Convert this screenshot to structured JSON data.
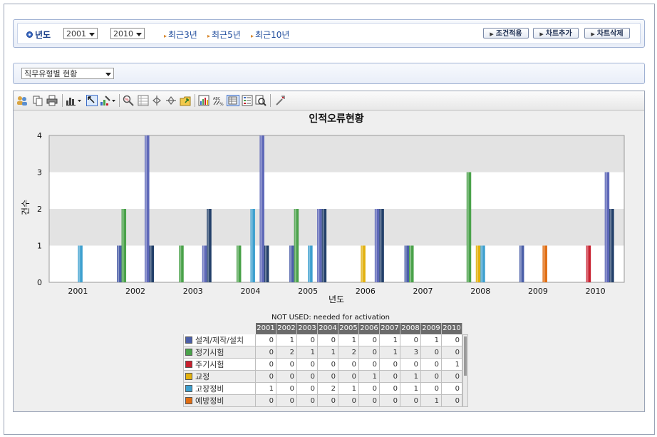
{
  "filter": {
    "year_label": "년도",
    "from_year": "2001",
    "to_year": "2010",
    "range_sep": "~",
    "quick": [
      "최근3년",
      "최근5년",
      "최근10년"
    ],
    "buttons": [
      "조건적용",
      "차트추가",
      "차트삭제"
    ]
  },
  "type_select": {
    "value": "직무유형별 현황"
  },
  "toolbar": {
    "icons": [
      "users-icon",
      "copy-icon",
      "print-icon",
      "bar-chart-icon",
      "fit-icon",
      "paint-icon",
      "zoom-icon",
      "grid-icon",
      "rotate-h-icon",
      "rotate-v-icon",
      "export-icon",
      "chart-gallery-icon",
      "data-label-icon",
      "data-table-icon",
      "legend-icon",
      "magnify-icon",
      "tools-icon"
    ]
  },
  "chart_data": {
    "type": "bar",
    "title": "인적오류현황",
    "xlabel": "년도",
    "ylabel": "건수",
    "ylim": [
      0,
      4
    ],
    "yticks": [
      "0",
      "1",
      "2",
      "3",
      "4"
    ],
    "grid": "horizontal bands",
    "categories": [
      "2001",
      "2002",
      "2003",
      "2004",
      "2005",
      "2006",
      "2007",
      "2008",
      "2009",
      "2010"
    ],
    "series": [
      {
        "name": "설계/제작/설치",
        "color": "#4b5fa8",
        "values": [
          0,
          1,
          0,
          0,
          1,
          0,
          1,
          0,
          1,
          0
        ]
      },
      {
        "name": "정기시험",
        "color": "#4aa24a",
        "values": [
          0,
          2,
          1,
          1,
          2,
          0,
          1,
          3,
          0,
          0
        ]
      },
      {
        "name": "주기시험",
        "color": "#c8202e",
        "values": [
          0,
          0,
          0,
          0,
          0,
          0,
          0,
          0,
          0,
          1
        ]
      },
      {
        "name": "교정",
        "color": "#e2b10f",
        "values": [
          0,
          0,
          0,
          0,
          0,
          1,
          0,
          1,
          0,
          0
        ]
      },
      {
        "name": "고장정비",
        "color": "#3ea0cf",
        "values": [
          1,
          0,
          0,
          2,
          1,
          0,
          0,
          1,
          0,
          0
        ]
      },
      {
        "name": "예방정비",
        "color": "#e06d12",
        "values": [
          0,
          0,
          0,
          0,
          0,
          0,
          0,
          0,
          1,
          0
        ]
      },
      {
        "name": "",
        "color": "#5e68b8",
        "values": [
          0,
          4,
          1,
          4,
          2,
          2,
          0,
          0,
          0,
          3
        ]
      },
      {
        "name": "",
        "color": "#23406a",
        "values": [
          0,
          1,
          2,
          1,
          2,
          2,
          0,
          0,
          0,
          2
        ]
      }
    ],
    "table_caption": "NOT USED: needed for activation"
  }
}
